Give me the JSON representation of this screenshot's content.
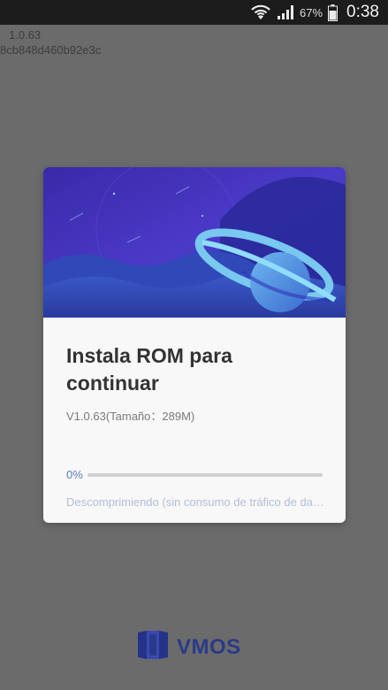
{
  "status_bar": {
    "battery": "67%",
    "time": "0:38"
  },
  "background": {
    "version": "1.0.63",
    "hash": "8cb848d460b92e3c"
  },
  "dialog": {
    "title": "Instala ROM para continuar",
    "subtitle": "V1.0.63(Tamaño：289M)",
    "progress_percent": "0%",
    "progress_value": 0,
    "status": "Descomprimiendo  (sin consumo de tráfico de datos)"
  },
  "logo": {
    "text": "VMOS"
  },
  "colors": {
    "accent": "#5a78c8",
    "banner_deep": "#3b2fb8",
    "brand": "#2a3a8a"
  }
}
